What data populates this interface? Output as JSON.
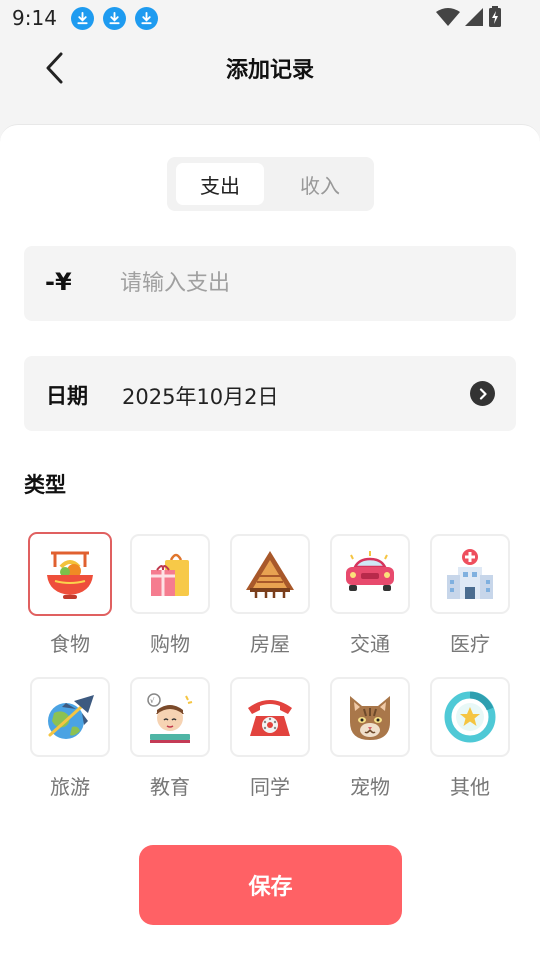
{
  "status_bar": {
    "time": "9:14",
    "download_icons": [
      "download-icon",
      "download-icon",
      "download-icon"
    ]
  },
  "header": {
    "title": "添加记录",
    "back_icon": "chevron-left-icon"
  },
  "type_toggle": {
    "options": [
      {
        "label": "支出",
        "active": true
      },
      {
        "label": "收入",
        "active": false
      }
    ]
  },
  "amount": {
    "prefix": "-¥",
    "value": "",
    "placeholder": "请输入支出"
  },
  "date": {
    "label": "日期",
    "value": "2025年10月2日",
    "icon": "chevron-right-circle-icon"
  },
  "category": {
    "title": "类型",
    "selected": "食物",
    "items": [
      {
        "label": "食物",
        "icon": "noodle-bowl-icon"
      },
      {
        "label": "购物",
        "icon": "shopping-bag-icon"
      },
      {
        "label": "房屋",
        "icon": "cabin-house-icon"
      },
      {
        "label": "交通",
        "icon": "car-icon"
      },
      {
        "label": "医疗",
        "icon": "hospital-icon"
      },
      {
        "label": "旅游",
        "icon": "airplane-globe-icon"
      },
      {
        "label": "教育",
        "icon": "student-icon"
      },
      {
        "label": "同学",
        "icon": "telephone-icon"
      },
      {
        "label": "宠物",
        "icon": "cat-icon"
      },
      {
        "label": "其他",
        "icon": "star-badge-icon"
      }
    ]
  },
  "save_button": {
    "label": "保存"
  },
  "colors": {
    "accent": "#ff6165",
    "selected_border": "#e06060",
    "download_blue": "#1e9bf0"
  }
}
